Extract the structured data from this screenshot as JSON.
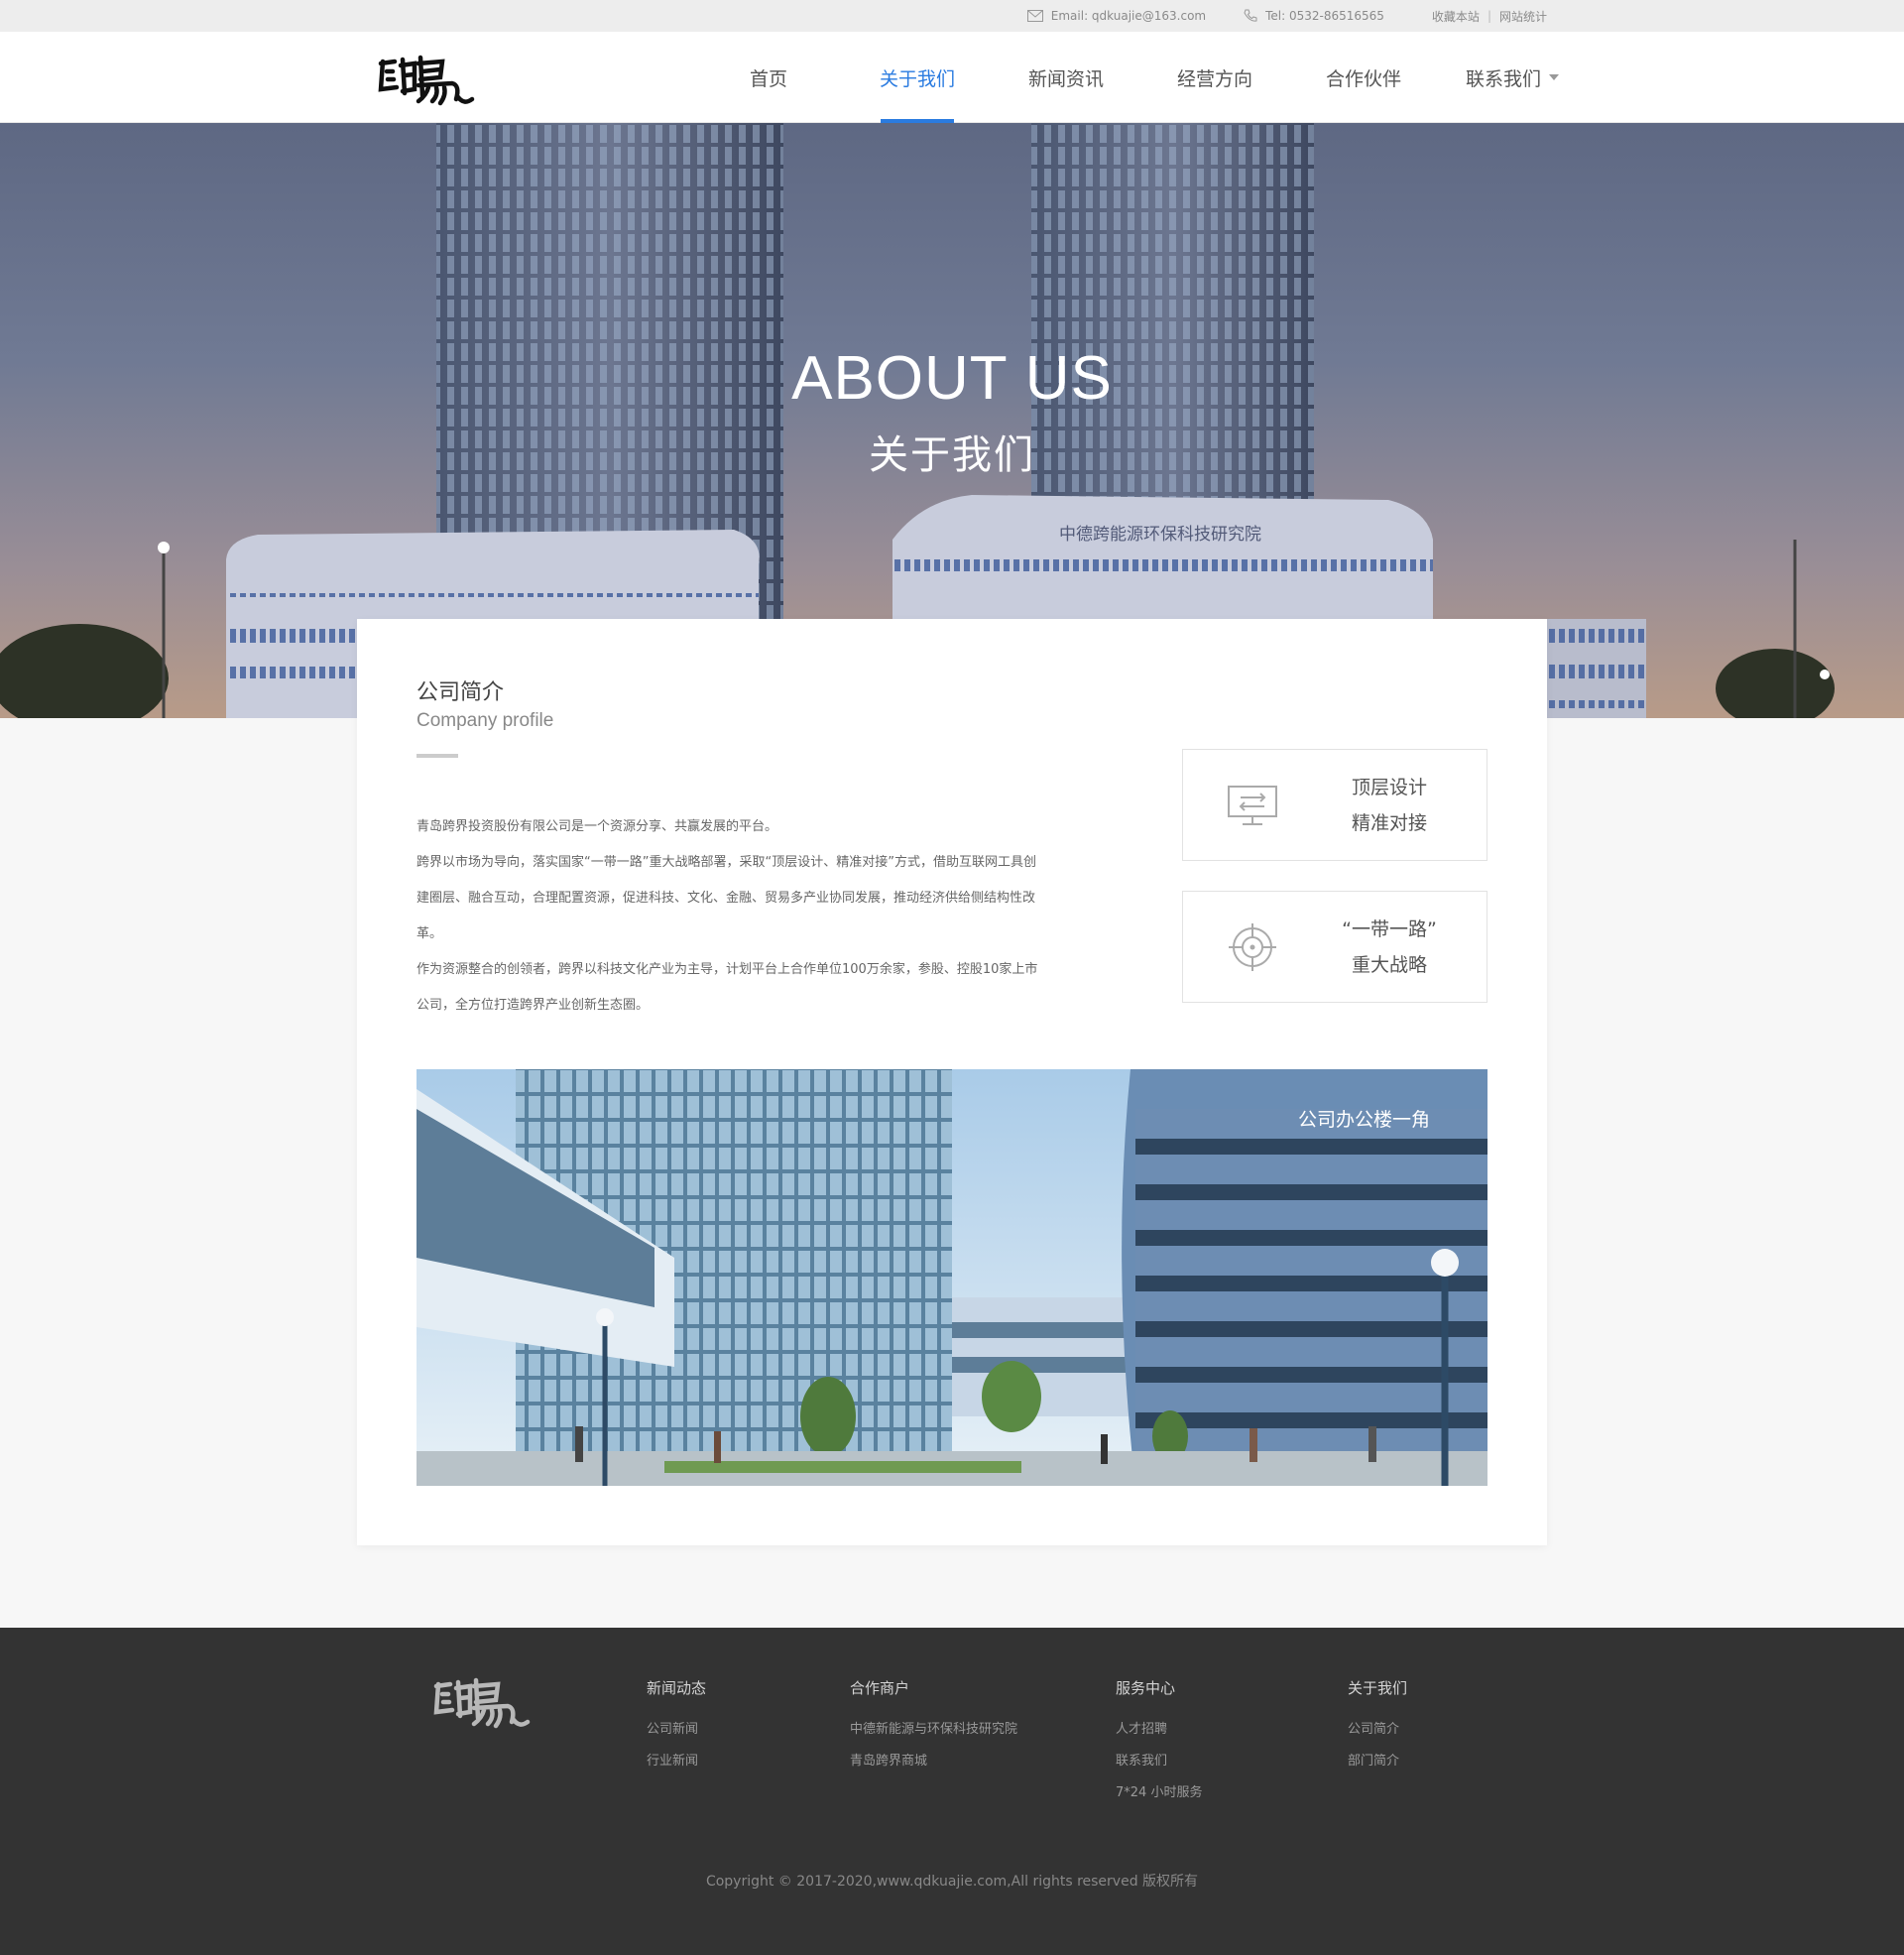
{
  "topbar": {
    "email": "Email: qdkuajie@163.com",
    "tel": "Tel: 0532-86516565",
    "bookmark": "收藏本站",
    "separator": "|",
    "stats": "网站统计"
  },
  "nav": {
    "items": [
      "首页",
      "关于我们",
      "新闻资讯",
      "经营方向",
      "合作伙伴",
      "联系我们"
    ],
    "active": "关于我们"
  },
  "banner": {
    "title": "ABOUT US",
    "subtitle": "关于我们",
    "building_sign": "中德跨能源环保科技研究院"
  },
  "profile": {
    "title": "公司简介",
    "subtitle": "Company profile",
    "paragraphs": [
      "青岛跨界投资股份有限公司是一个资源分享、共赢发展的平台。",
      "跨界以市场为导向，落实国家“一带一路”重大战略部署，采取“顶层设计、精准对接”方式，借助互联网工具创建圈层、融合互动，合理配置资源，促进科技、文化、金融、贸易多产业协同发展，推动经济供给侧结构性改革。",
      "作为资源整合的创领者，跨界以科技文化产业为主导，计划平台上合作单位100万余家，参股、控股10家上市公司，全方位打造跨界产业创新生态圈。"
    ]
  },
  "features": [
    {
      "icon": "monitor-icon",
      "line1": "顶层设计",
      "line2": "精准对接"
    },
    {
      "icon": "target-icon",
      "line1": "“一带一路”",
      "line2": "重大战略"
    }
  ],
  "photo": {
    "caption": "公司办公楼一角"
  },
  "footer": {
    "columns": [
      {
        "title": "新闻动态",
        "links": [
          "公司新闻",
          "行业新闻"
        ]
      },
      {
        "title": "合作商户",
        "links": [
          "中德新能源与环保科技研究院",
          "青岛跨界商城"
        ]
      },
      {
        "title": "服务中心",
        "links": [
          "人才招聘",
          "联系我们",
          "7*24 小时服务"
        ]
      },
      {
        "title": "关于我们",
        "links": [
          "公司简介",
          "部门简介"
        ]
      }
    ],
    "copyright": "Copyright © 2017-2020,www.qdkuajie.com,All rights reserved 版权所有"
  },
  "colors": {
    "accent": "#2a7be0",
    "footer_bg": "#333333",
    "topbar_bg": "#ededed"
  }
}
